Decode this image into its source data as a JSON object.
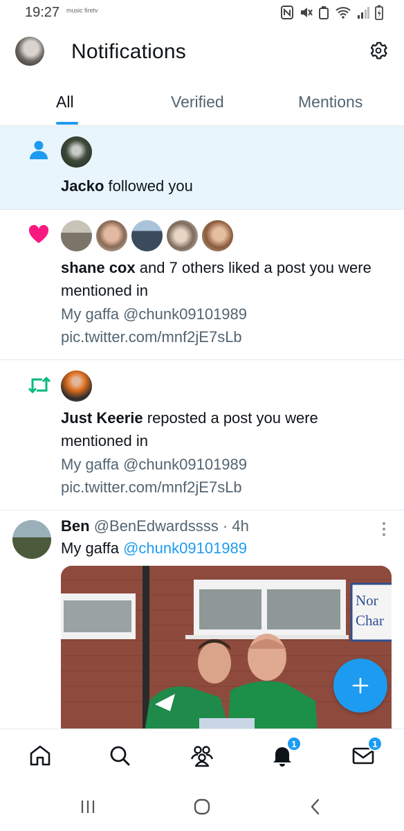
{
  "status_bar": {
    "time": "19:27",
    "app_icons": [
      "music",
      "firetv"
    ],
    "icons": [
      "nfc-icon",
      "mute-icon",
      "recycle-icon",
      "wifi-icon",
      "signal-icon",
      "battery-icon"
    ]
  },
  "header": {
    "title": "Notifications",
    "settings_icon": "gear-icon"
  },
  "tabs": [
    {
      "label": "All",
      "active": true
    },
    {
      "label": "Verified",
      "active": false
    },
    {
      "label": "Mentions",
      "active": false
    }
  ],
  "notifications": [
    {
      "type": "follow",
      "icon": "person-icon",
      "icon_color": "#1d9bf0",
      "unread": true,
      "actor": "Jacko",
      "action": " followed you"
    },
    {
      "type": "like",
      "icon": "heart-icon",
      "icon_color": "#f91880",
      "actor": "shane cox",
      "action": " and 7 others liked a post you were mentioned in",
      "post_text_line1": "My gaffa @chunk09101989",
      "post_text_line2": "pic.twitter.com/mnf2jE7sLb"
    },
    {
      "type": "repost",
      "icon": "repost-icon",
      "icon_color": "#00ba7c",
      "actor": "Just Keerie",
      "action": " reposted a post you were mentioned in",
      "post_text_line1": "My gaffa @chunk09101989",
      "post_text_line2": "pic.twitter.com/mnf2jE7sLb"
    }
  ],
  "tweet": {
    "name": "Ben",
    "handle": "@BenEdwardssss",
    "separator": "·",
    "time": "4h",
    "text": "My gaffa ",
    "mention": "@chunk09101989",
    "sign_text_line1": "Nor",
    "sign_text_line2": "Char"
  },
  "fab": {
    "icon": "plus-icon"
  },
  "bottom_nav": {
    "items": [
      "home-icon",
      "search-icon",
      "communities-icon",
      "bell-icon",
      "mail-icon"
    ],
    "notifications_badge": "1",
    "messages_badge": "1"
  },
  "system_nav": [
    "recents-icon",
    "home-circle-icon",
    "back-icon"
  ],
  "colors": {
    "accent": "#1d9bf0",
    "unread_bg": "#e8f5fd",
    "like": "#f91880",
    "repost": "#00ba7c"
  }
}
